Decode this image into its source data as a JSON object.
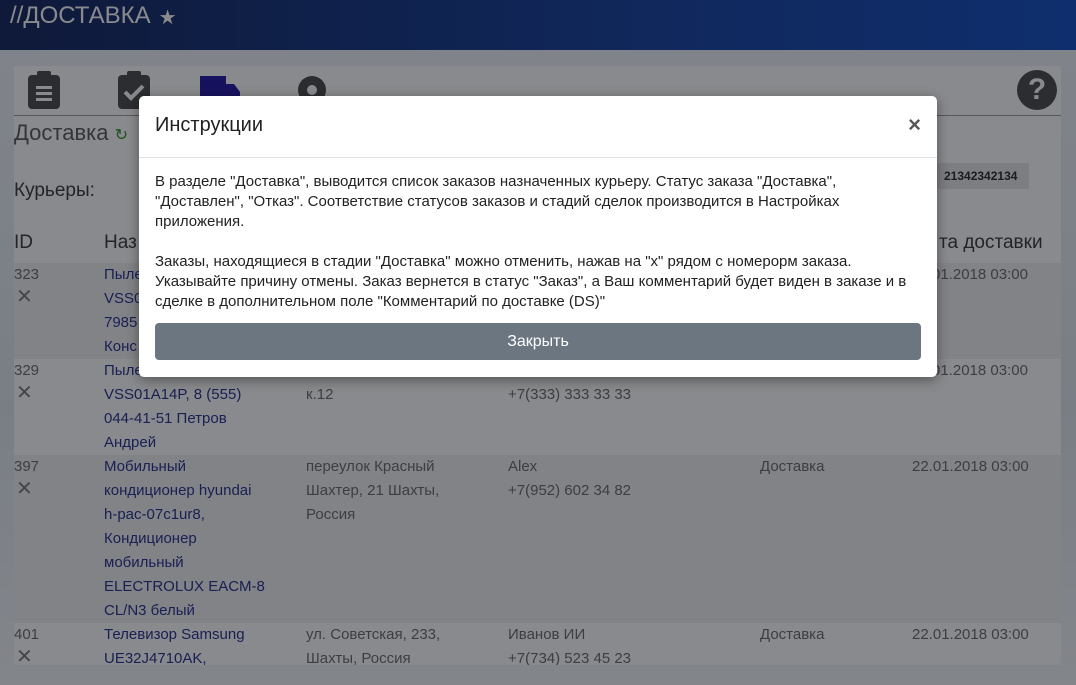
{
  "header": {
    "title": "//ДОСТАВКА"
  },
  "page": {
    "title": "Доставка",
    "couriers_label": "Курьеры:",
    "courier_badge": "21342342134"
  },
  "table": {
    "headers": [
      "ID",
      "Наз",
      "та доставки"
    ],
    "rows": [
      {
        "id": "323",
        "name": [
          "Пыле",
          "VSS0",
          "7985",
          "Конс"
        ],
        "address": [],
        "contact": [],
        "status": "",
        "date": "01.2018 03:00"
      },
      {
        "id": "329",
        "name": [
          "Пыле",
          "VSS01A14P, 8 (555)",
          "044-41-51 Петров",
          "Андрей"
        ],
        "address": [
          "",
          "к.12"
        ],
        "contact": [
          "",
          "+7(333) 333 33 33"
        ],
        "status": "",
        "date": "01.2018 03:00"
      },
      {
        "id": "397",
        "name": [
          "Мобильный",
          "кондиционер hyundai",
          "h-pac-07c1ur8,",
          "Кондиционер",
          "мобильный",
          "ELECTROLUX EACM-8",
          "CL/N3 белый"
        ],
        "address": [
          "переулок Красный",
          "Шахтер, 21 Шахты,",
          "Россия"
        ],
        "contact": [
          "Alex",
          "+7(952) 602 34 82"
        ],
        "status": "Доставка",
        "date": "22.01.2018 03:00"
      },
      {
        "id": "401",
        "name": [
          "Телевизор Samsung",
          "UE32J4710AK,"
        ],
        "address": [
          "ул. Советская, 233,",
          "Шахты, Россия"
        ],
        "contact": [
          "Иванов ИИ",
          "+7(734) 523 45 23"
        ],
        "status": "Доставка",
        "date": "22.01.2018 03:00"
      }
    ]
  },
  "modal": {
    "title": "Инструкции",
    "close": "×",
    "p1": "В разделе \"Доставка\", выводится список заказов назначенных курьеру. Статус заказа \"Доставка\", \"Доставлен\", \"Отказ\". Соответствие статусов заказов и стадий сделок производится в Настройках приложения.",
    "p2": "Заказы, находящиеся в стадии \"Доставка\" можно отменить, нажав на \"x\" рядом с номерорм заказа. Указывайте причину отмены. Заказ вернется в статус \"Заказ\", а Ваш комментарий будет виден в заказе и в сделке в дополнительном поле \"Комментарий по доставке (DS)\"",
    "button": "Закрыть"
  }
}
